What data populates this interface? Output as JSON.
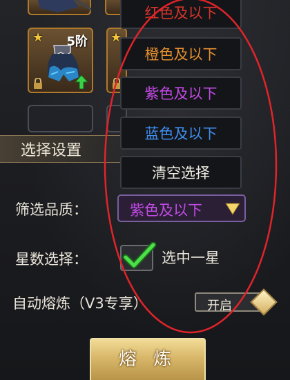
{
  "items": [
    {
      "grade": "5阶"
    }
  ],
  "quality_dropdown": {
    "options": [
      {
        "label": "红色及以下",
        "color": "#d7342a"
      },
      {
        "label": "橙色及以下",
        "color": "#e7902e"
      },
      {
        "label": "紫色及以下",
        "color": "#c24ae6"
      },
      {
        "label": "蓝色及以下",
        "color": "#3f8ff0"
      },
      {
        "label": "清空选择",
        "color": "#f0ece4"
      }
    ]
  },
  "settings": {
    "title": "选择设置",
    "quality_label": "筛选品质：",
    "quality_value": "紫色及以下",
    "star_label": "星数选择：",
    "star_option": "选中一星",
    "star_checked": true,
    "auto_label": "自动熔炼（V3专享）",
    "auto_toggle": "开启"
  },
  "action": {
    "smelt_label": "熔 炼"
  },
  "colors": {
    "annotation": "#e0242a",
    "gold": "#d8b76a",
    "purple": "#c24ae6"
  }
}
